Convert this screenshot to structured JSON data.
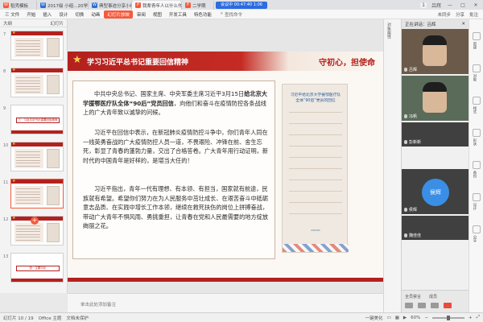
{
  "tabs": [
    {
      "label": "稻壳模板",
      "icon_color": "#f55a3c",
      "icon_glyph": "W"
    },
    {
      "label": "2017级 小组...20学年第二学期",
      "icon_color": "#2f6fd6",
      "icon_glyph": "W"
    },
    {
      "label": "典型事迹分享小组.docx",
      "icon_color": "#2f6fd6",
      "icon_glyph": "W"
    },
    {
      "label": "我辈青年人以什么作为",
      "icon_color": "#f55a3c",
      "icon_glyph": "P"
    },
    {
      "label": "二学期",
      "icon_color": "#f55a3c",
      "icon_glyph": "P"
    },
    {
      "label": "演示文稿1",
      "icon_color": "#f55a3c",
      "icon_glyph": "P"
    }
  ],
  "meeting_banner": "会议中 00:47:40 1:06",
  "tab_right": {
    "badge": "1",
    "user": "吕辉"
  },
  "menu": {
    "items": [
      "三 文件",
      "开始",
      "插入",
      "设计",
      "切换",
      "动画",
      "幻灯片放映",
      "审阅",
      "视图",
      "开发工具",
      "特色功能"
    ],
    "active_index": 6,
    "search": "查找命令",
    "right_items": [
      "未同步",
      "分享",
      "批注"
    ]
  },
  "thumbs": {
    "header": "大纲",
    "header_right": "幻灯片",
    "items": [
      {
        "num": "7",
        "kind": "content",
        "title": ""
      },
      {
        "num": "8",
        "kind": "content",
        "title": ""
      },
      {
        "num": "9",
        "kind": "section",
        "title": "三 · 习近平总书记重要回信精神"
      },
      {
        "num": "10",
        "kind": "content",
        "title": ""
      },
      {
        "num": "11",
        "kind": "content",
        "title": ""
      },
      {
        "num": "12",
        "kind": "content",
        "title": ""
      },
      {
        "num": "13",
        "kind": "section",
        "title": "四 · 主题讨论"
      }
    ],
    "selected_index": 4
  },
  "slide": {
    "title": "学习习近平总书记重要回信精神",
    "slogan": "守初心，担使命",
    "paragraphs": [
      {
        "pre": "中共中央总书记、国家主席、中央军委主席习近平3月15日",
        "bold": "给北京大学援鄂医疗队全体“90后”党员回信",
        "post": "，向他们和奋斗在疫情防控各条战线上的广大青年致以诚挚的问候。"
      },
      {
        "pre": "习近平在回信中表示，在新冠肺炎疫情防控斗争中，你们青年人同在一线英勇奋战的广大疫情防控人员一道，不畏艰险、冲锋在前、舍生忘死，彰显了青春的蓬勃力量，交出了合格答卷。广大青年用行动证明，新时代的中国青年是好样的，是堪当大任的！",
        "bold": "",
        "post": ""
      },
      {
        "pre": "习近平指出，青年一代有理想、有本领、有担当，国家就有前途，民族就有希望。希望你们努力在为人民服务中茁壮成长、在艰苦奋斗中砥砺意志品质、在实践中增长工作本领，继续在救死扶伤的岗位上拼搏奋战，带动广大青年不惧风雨、勇挑重担，让青春在党和人民最需要的地方绽放绚丽之花。",
        "bold": "",
        "post": ""
      }
    ],
    "poster_title": "习近平给北京大学援鄂医疗队全体“90后”党员的回信"
  },
  "notes": "单击此处添加备注",
  "status": {
    "slide_pos": "幻灯片 10 / 19",
    "theme": "Office 主题",
    "protect": "文档未保护",
    "beautify": "一键美化",
    "zoom": "60%"
  },
  "props_label": "对象属性",
  "meeting": {
    "header": "正在讲话：吕辉",
    "participants": [
      {
        "name": "吕辉",
        "type": "video",
        "color": "#6b5a4a"
      },
      {
        "name": "冯帆",
        "type": "video",
        "color": "#5a6b5a"
      },
      {
        "name": "彭新新",
        "type": "placeholder",
        "color": "#4a4a4a"
      },
      {
        "name": "侯辉",
        "type": "avatar",
        "color": "#3a8ee6"
      },
      {
        "name": "魏佳佳",
        "type": "placeholder",
        "color": "#4a4a4a"
      }
    ],
    "bottom": {
      "labels": [
        "全员禁言",
        "成员"
      ],
      "buttons": [
        "mic",
        "camera",
        "share",
        "leave"
      ]
    }
  },
  "far_right": {
    "items": [
      "新建",
      "对象",
      "样式",
      "形状",
      "备份",
      "设计",
      "分享"
    ]
  }
}
